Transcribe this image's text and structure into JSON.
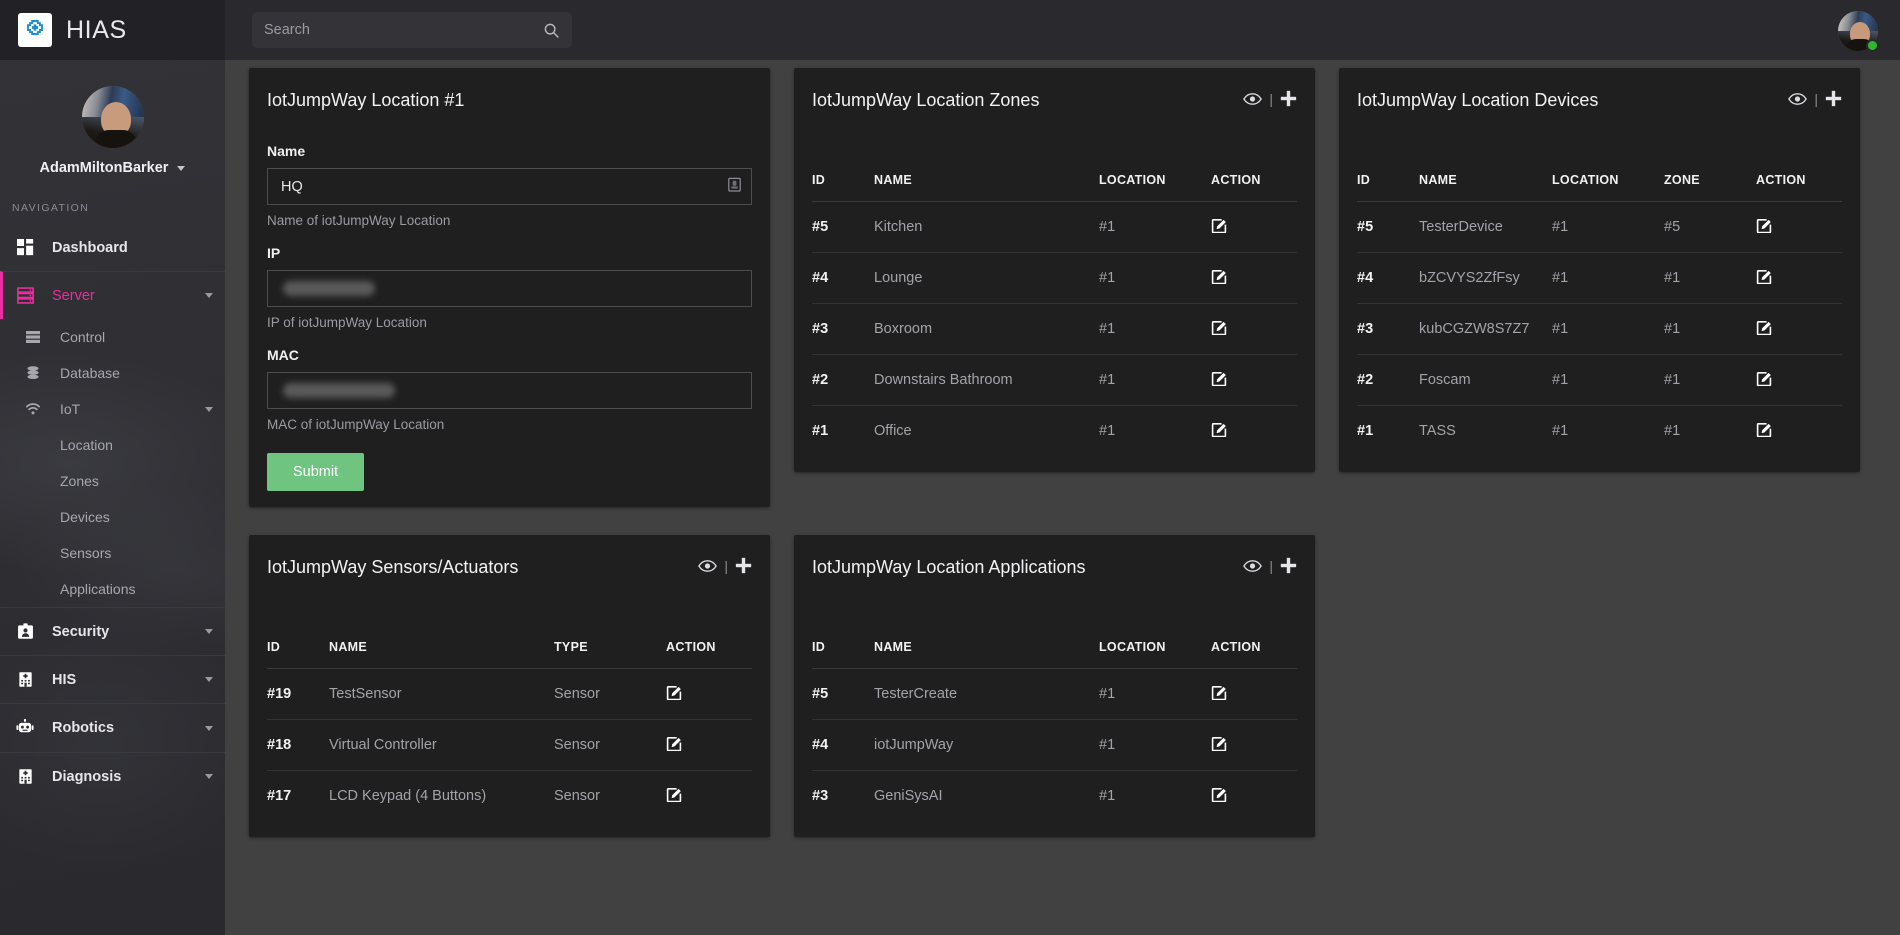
{
  "app": {
    "brand": "HIAS",
    "logo_icon": "medical-cross-icon"
  },
  "topbar": {
    "search_placeholder": "Search",
    "search_value": "",
    "search_icon": "search-icon",
    "avatar_status": "online"
  },
  "sidebar": {
    "user_name": "AdamMiltonBarker",
    "nav_heading": "NAVIGATION",
    "items": [
      {
        "label": "Dashboard",
        "icon": "dashboard-grid-icon",
        "active": false,
        "expandable": false
      },
      {
        "label": "Server",
        "icon": "server-rack-icon",
        "active": true,
        "expandable": true
      },
      {
        "label": "Security",
        "icon": "id-badge-icon",
        "active": false,
        "expandable": true
      },
      {
        "label": "HIS",
        "icon": "hospital-icon",
        "active": false,
        "expandable": true
      },
      {
        "label": "Robotics",
        "icon": "robot-icon",
        "active": false,
        "expandable": true
      },
      {
        "label": "Diagnosis",
        "icon": "hospital-icon",
        "active": false,
        "expandable": true
      }
    ],
    "server_children": [
      {
        "label": "Control",
        "icon": "server-lines-icon",
        "expandable": false
      },
      {
        "label": "Database",
        "icon": "database-icon",
        "expandable": false
      },
      {
        "label": "IoT",
        "icon": "wifi-icon",
        "expandable": true
      }
    ],
    "iot_children": [
      {
        "label": "Location"
      },
      {
        "label": "Zones"
      },
      {
        "label": "Devices"
      },
      {
        "label": "Sensors"
      },
      {
        "label": "Applications"
      }
    ]
  },
  "cards": {
    "location_form": {
      "title": "IotJumpWay Location #1",
      "fields": [
        {
          "label": "Name",
          "value": "HQ",
          "hint": "Name of iotJumpWay Location",
          "redacted": false,
          "trailing_icon": "clipboard-icon"
        },
        {
          "label": "IP",
          "value": "",
          "hint": "IP of iotJumpWay Location",
          "redacted": true,
          "trailing_icon": ""
        },
        {
          "label": "MAC",
          "value": "",
          "hint": "MAC of iotJumpWay Location",
          "redacted": true,
          "trailing_icon": ""
        }
      ],
      "submit_label": "Submit"
    },
    "zones": {
      "title": "IotJumpWay Location Zones",
      "view_icon": "eye-icon",
      "add_icon": "plus-icon",
      "columns": [
        "ID",
        "NAME",
        "LOCATION",
        "ACTION"
      ],
      "rows": [
        {
          "id": "#5",
          "name": "Kitchen",
          "location": "#1",
          "action": "edit-icon"
        },
        {
          "id": "#4",
          "name": "Lounge",
          "location": "#1",
          "action": "edit-icon"
        },
        {
          "id": "#3",
          "name": "Boxroom",
          "location": "#1",
          "action": "edit-icon"
        },
        {
          "id": "#2",
          "name": "Downstairs Bathroom",
          "location": "#1",
          "action": "edit-icon"
        },
        {
          "id": "#1",
          "name": "Office",
          "location": "#1",
          "action": "edit-icon"
        }
      ]
    },
    "devices": {
      "title": "IotJumpWay Location Devices",
      "view_icon": "eye-icon",
      "add_icon": "plus-icon",
      "columns": [
        "ID",
        "NAME",
        "LOCATION",
        "ZONE",
        "ACTION"
      ],
      "rows": [
        {
          "id": "#5",
          "name": "TesterDevice",
          "location": "#1",
          "zone": "#5",
          "action": "edit-icon"
        },
        {
          "id": "#4",
          "name": "bZCVYS2ZfFsy",
          "location": "#1",
          "zone": "#1",
          "action": "edit-icon"
        },
        {
          "id": "#3",
          "name": "kubCGZW8S7Z7",
          "location": "#1",
          "zone": "#1",
          "action": "edit-icon"
        },
        {
          "id": "#2",
          "name": "Foscam",
          "location": "#1",
          "zone": "#1",
          "action": "edit-icon"
        },
        {
          "id": "#1",
          "name": "TASS",
          "location": "#1",
          "zone": "#1",
          "action": "edit-icon"
        }
      ]
    },
    "sensors": {
      "title": "IotJumpWay Sensors/Actuators",
      "view_icon": "eye-icon",
      "add_icon": "plus-icon",
      "columns": [
        "ID",
        "NAME",
        "TYPE",
        "ACTION"
      ],
      "rows": [
        {
          "id": "#19",
          "name": "TestSensor",
          "type": "Sensor",
          "action": "edit-icon"
        },
        {
          "id": "#18",
          "name": "Virtual Controller",
          "type": "Sensor",
          "action": "edit-icon"
        },
        {
          "id": "#17",
          "name": "LCD Keypad (4 Buttons)",
          "type": "Sensor",
          "action": "edit-icon"
        }
      ]
    },
    "applications": {
      "title": "IotJumpWay Location Applications",
      "view_icon": "eye-icon",
      "add_icon": "plus-icon",
      "columns": [
        "ID",
        "NAME",
        "LOCATION",
        "ACTION"
      ],
      "rows": [
        {
          "id": "#5",
          "name": "TesterCreate",
          "location": "#1",
          "action": "edit-icon"
        },
        {
          "id": "#4",
          "name": "iotJumpWay",
          "location": "#1",
          "action": "edit-icon"
        },
        {
          "id": "#3",
          "name": "GeniSysAI",
          "location": "#1",
          "action": "edit-icon"
        }
      ]
    }
  },
  "colors": {
    "accent_pink": "#ec2ca0",
    "brand_blue": "#1d8ecf",
    "submit_green": "#6fc57f",
    "page_bg": "#414141",
    "card_bg": "#1f1f1f",
    "sidebar_bg": "#2e2e33",
    "topbar_bg": "#2a2a2e",
    "status_green": "#2eb82e"
  }
}
